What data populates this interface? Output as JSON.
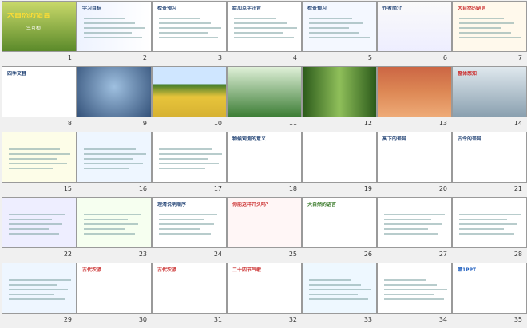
{
  "slides": [
    {
      "n": "1",
      "title": "大自然的语言",
      "sub": "竺可桢"
    },
    {
      "n": "2",
      "title": "学习目标"
    },
    {
      "n": "3",
      "title": "检查预习"
    },
    {
      "n": "4",
      "title": "给加点字注音"
    },
    {
      "n": "5",
      "title": "检查预习"
    },
    {
      "n": "6",
      "title": "作者简介"
    },
    {
      "n": "7",
      "title": "大自然的语言"
    },
    {
      "n": "8",
      "title": "四季交替"
    },
    {
      "n": "9"
    },
    {
      "n": "10"
    },
    {
      "n": "11"
    },
    {
      "n": "12"
    },
    {
      "n": "13"
    },
    {
      "n": "14",
      "title": "整体感知"
    },
    {
      "n": "15"
    },
    {
      "n": "16"
    },
    {
      "n": "17"
    },
    {
      "n": "18",
      "title": "物候观测的意义"
    },
    {
      "n": "19"
    },
    {
      "n": "20",
      "title": "高下的差异"
    },
    {
      "n": "21",
      "title": "古今的差异"
    },
    {
      "n": "22"
    },
    {
      "n": "23"
    },
    {
      "n": "24",
      "title": "理清说明顺序"
    },
    {
      "n": "25",
      "title": "你能这样开头吗？"
    },
    {
      "n": "26",
      "title": "大自然的语言"
    },
    {
      "n": "27"
    },
    {
      "n": "28"
    },
    {
      "n": "29"
    },
    {
      "n": "30",
      "title": "古代农谚"
    },
    {
      "n": "31",
      "title": "古代农谚"
    },
    {
      "n": "32",
      "title": "二十四节气歌"
    },
    {
      "n": "33"
    },
    {
      "n": "34"
    },
    {
      "n": "35",
      "title": "第1PPT"
    }
  ]
}
